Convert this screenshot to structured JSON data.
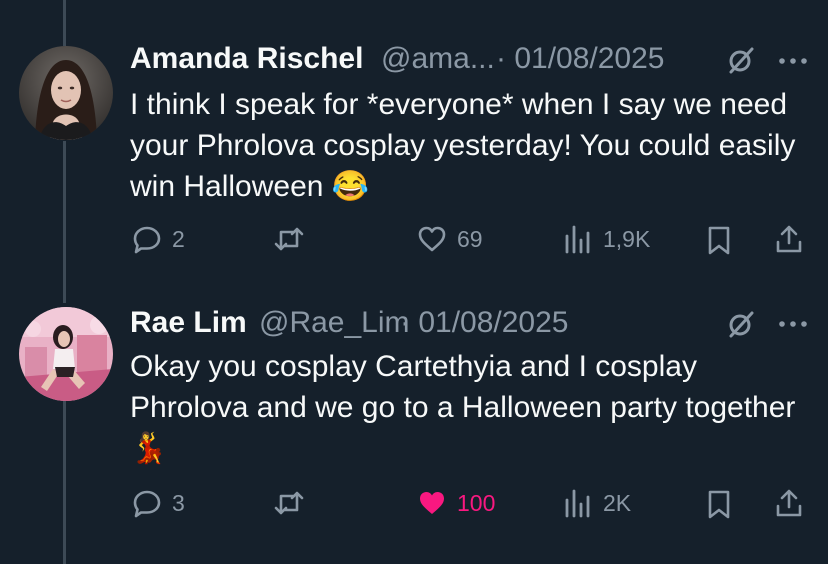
{
  "posts": [
    {
      "name": "Amanda Rischel",
      "handle": "@ama...",
      "date": "· 01/08/2025",
      "text": "I think I speak for *everyone* when I say we need your Phrolova cosplay yesterday! You could easily win Halloween",
      "emoji": "😂",
      "replies": "2",
      "likes": "69",
      "views": "1,9K",
      "liked": false
    },
    {
      "name": "Rae Lim",
      "handle": "@Rae_Lim",
      "date": "· 01/08/2025",
      "text": "Okay you cosplay Cartethyia and I cosplay Phrolova and we go to a Halloween party together",
      "emoji": "💃",
      "replies": "3",
      "likes": "100",
      "views": "2K",
      "liked": true
    }
  ],
  "colors": {
    "background": "#15202b",
    "muted": "#8b98a5",
    "like_active": "#f91880",
    "thread_line": "#3d4a56"
  },
  "icons": [
    "reply-icon",
    "retweet-icon",
    "like-icon",
    "views-icon",
    "bookmark-icon",
    "share-icon",
    "grok-icon",
    "more-icon"
  ]
}
